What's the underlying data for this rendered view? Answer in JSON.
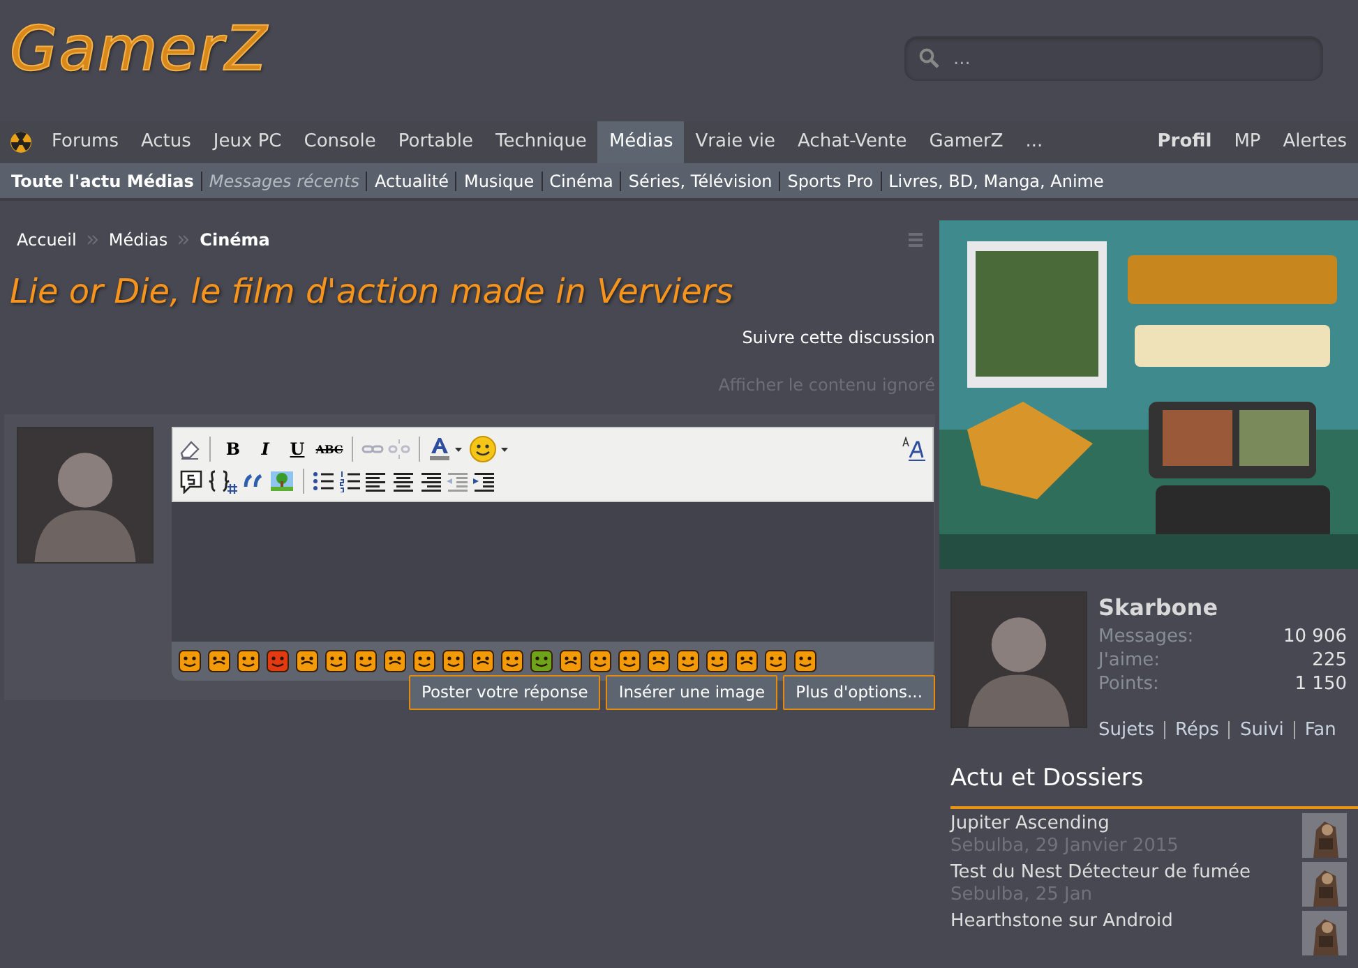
{
  "logo": "GamerZ",
  "search": {
    "placeholder": "..."
  },
  "nav": {
    "items": [
      {
        "label": "Forums",
        "selected": false
      },
      {
        "label": "Actus",
        "selected": false
      },
      {
        "label": "Jeux PC",
        "selected": false
      },
      {
        "label": "Console",
        "selected": false
      },
      {
        "label": "Portable",
        "selected": false
      },
      {
        "label": "Technique",
        "selected": false
      },
      {
        "label": "Médias",
        "selected": true
      },
      {
        "label": "Vraie vie",
        "selected": false
      },
      {
        "label": "Achat-Vente",
        "selected": false
      },
      {
        "label": "GamerZ",
        "selected": false
      },
      {
        "label": "...",
        "selected": false
      }
    ],
    "right": [
      {
        "label": "Profil",
        "kind": "strong"
      },
      {
        "label": "MP",
        "kind": "plain"
      },
      {
        "label": "Alertes",
        "kind": "plain"
      }
    ]
  },
  "subnav": [
    {
      "label": "Toute l'actu Médias",
      "kind": "heading"
    },
    {
      "label": "Messages récents",
      "kind": "recent"
    },
    {
      "label": "Actualité",
      "kind": "link"
    },
    {
      "label": "Musique",
      "kind": "link"
    },
    {
      "label": "Cinéma",
      "kind": "link"
    },
    {
      "label": "Séries, Télévision",
      "kind": "link"
    },
    {
      "label": "Sports Pro",
      "kind": "link"
    },
    {
      "label": "Livres, BD, Manga, Anime",
      "kind": "link"
    }
  ],
  "breadcrumb": [
    {
      "label": "Accueil",
      "current": false
    },
    {
      "label": "Médias",
      "current": false
    },
    {
      "label": "Cinéma",
      "current": true
    }
  ],
  "thread": {
    "title": "Lie or Die, le film d'action made in Verviers",
    "follow": "Suivre cette discussion",
    "ignored": "Afficher le contenu ignoré"
  },
  "editor": {
    "format_glyphs": [
      "B",
      "I",
      "U",
      "ABC"
    ],
    "smileys": [
      {
        "color": "#f39a0a"
      },
      {
        "color": "#f39a0a"
      },
      {
        "color": "#f39a0a"
      },
      {
        "color": "#e23a12"
      },
      {
        "color": "#f39a0a"
      },
      {
        "color": "#f39a0a"
      },
      {
        "color": "#f39a0a"
      },
      {
        "color": "#f39a0a"
      },
      {
        "color": "#f39a0a"
      },
      {
        "color": "#f39a0a"
      },
      {
        "color": "#f39a0a"
      },
      {
        "color": "#f39a0a"
      },
      {
        "color": "#6ea31c"
      },
      {
        "color": "#f39a0a"
      },
      {
        "color": "#f39a0a"
      },
      {
        "color": "#f39a0a"
      },
      {
        "color": "#f39a0a"
      },
      {
        "color": "#f39a0a"
      },
      {
        "color": "#f39a0a"
      },
      {
        "color": "#f39a0a"
      },
      {
        "color": "#f39a0a"
      },
      {
        "color": "#f39a0a"
      }
    ],
    "buttons": [
      "Poster votre réponse",
      "Insérer une image",
      "Plus d'options..."
    ]
  },
  "profile": {
    "name": "Skarbone",
    "stats": [
      {
        "label": "Messages:",
        "value": "10 906"
      },
      {
        "label": "J'aime:",
        "value": "225"
      },
      {
        "label": "Points:",
        "value": "1 150"
      }
    ],
    "links": [
      "Sujets",
      "Réps",
      "Suivi",
      "Fan"
    ]
  },
  "news": {
    "title": "Actu et Dossiers",
    "items": [
      {
        "title": "Jupiter Ascending",
        "meta": "Sebulba, 29 Janvier 2015"
      },
      {
        "title": "Test du Nest Détecteur de fumée",
        "meta": "Sebulba, 25 Jan"
      },
      {
        "title": "Hearthstone sur Android"
      }
    ]
  }
}
